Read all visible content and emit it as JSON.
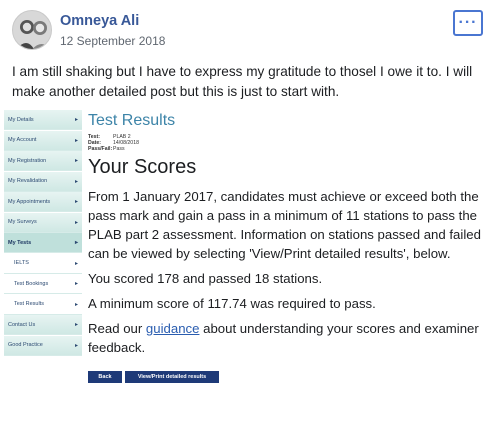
{
  "post": {
    "author": "Omneya Ali",
    "date": "12 September 2018",
    "more_label": "···",
    "text": "I am still shaking but I have to express my gratitude to thosel I owe it to. I will make another detailed post but this is just to start with."
  },
  "sidebar": {
    "items": [
      {
        "label": "My Details"
      },
      {
        "label": "My Account"
      },
      {
        "label": "My Registration"
      },
      {
        "label": "My Revalidation"
      },
      {
        "label": "My Appointments"
      },
      {
        "label": "My Surveys"
      },
      {
        "label": "My Tests"
      },
      {
        "label": "IELTS"
      },
      {
        "label": "Test Bookings"
      },
      {
        "label": "Test Results"
      },
      {
        "label": "Contact Us"
      },
      {
        "label": "Good Practice"
      }
    ]
  },
  "results": {
    "title": "Test Results",
    "meta": {
      "test_key": "Test:",
      "test_val": "PLAB 2",
      "date_key": "Date:",
      "date_val": "14/08/2018",
      "pass_key": "Pass/Fail:",
      "pass_val": "Pass"
    },
    "heading": "Your Scores",
    "paragraph": "From 1 January 2017, candidates must achieve or exceed both the pass mark and gain a pass in a minimum of 11 stations to pass the PLAB part 2 assessment. Information on stations passed and failed can be viewed by selecting 'View/Print detailed results', below.",
    "scored_line": "You scored 178 and passed 18 stations.",
    "min_line": "A minimum score of 117.74 was required to pass.",
    "guide_pre": "Read our ",
    "guide_link": "guidance",
    "guide_post": " about understanding your scores and examiner feedback.",
    "back_button": "Back",
    "view_button": "View/Print detailed results"
  }
}
